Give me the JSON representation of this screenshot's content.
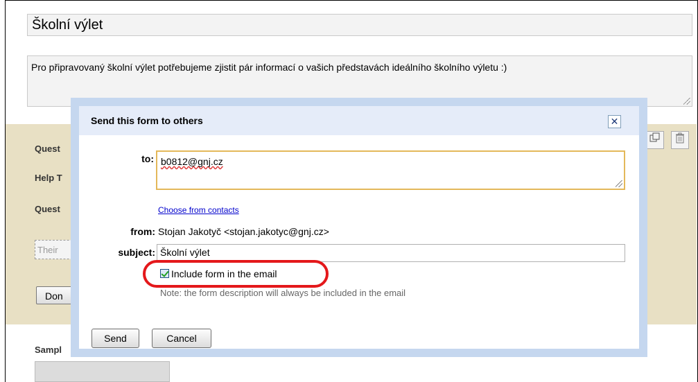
{
  "form": {
    "title": "Školní výlet",
    "description": "Pro připravovaný školní výlet potřebujeme zjistit pár informací o vašich představách ideálního školního výletu :)",
    "question_label": "Quest",
    "help_label": "Help T",
    "question_type_label": "Quest",
    "answer_placeholder": "Their",
    "done_label": "Don",
    "sample_label": "Sampl"
  },
  "icons": {
    "duplicate": "duplicate-icon",
    "delete": "trash-icon"
  },
  "dialog": {
    "title": "Send this form to others",
    "close_glyph": "✕",
    "to_label": "to:",
    "to_value": "b0812@gnj.cz",
    "choose_contacts": "Choose from contacts",
    "from_label": "from:",
    "from_value": "Stojan Jakotyč <stojan.jakotyc@gnj.cz>",
    "subject_label": "subject:",
    "subject_value": "Školní výlet",
    "include_label": "Include form in the email",
    "include_checked": true,
    "note": "Note: the form description will always be included in the email",
    "send_label": "Send",
    "cancel_label": "Cancel"
  },
  "colors": {
    "dialog_border": "#c5d7ef",
    "dialog_header": "#e5ecf9",
    "question_panel": "#e8e0c4",
    "highlight": "#e4181b",
    "link": "#0000cc"
  }
}
